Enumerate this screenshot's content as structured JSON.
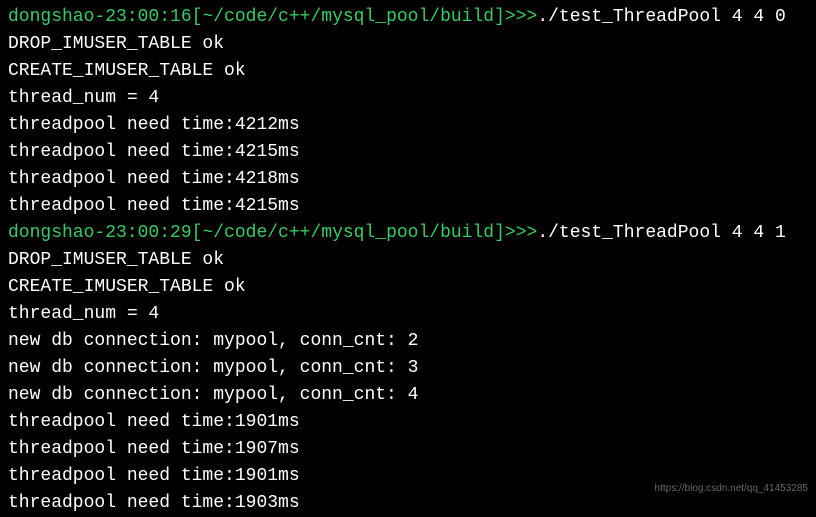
{
  "lines": [
    {
      "type": "prompt",
      "user": "dongshao-23:00:16",
      "path": "[~/code/c++/mysql_pool/build]",
      "arrows": ">>>",
      "command": "./test_ThreadPool 4 4 0"
    },
    {
      "type": "output",
      "text": "DROP_IMUSER_TABLE ok"
    },
    {
      "type": "output",
      "text": "CREATE_IMUSER_TABLE ok"
    },
    {
      "type": "output",
      "text": "thread_num = 4"
    },
    {
      "type": "output",
      "text": "threadpool need time:4212ms"
    },
    {
      "type": "output",
      "text": "threadpool need time:4215ms"
    },
    {
      "type": "output",
      "text": "threadpool need time:4218ms"
    },
    {
      "type": "output",
      "text": "threadpool need time:4215ms"
    },
    {
      "type": "prompt",
      "user": "dongshao-23:00:29",
      "path": "[~/code/c++/mysql_pool/build]",
      "arrows": ">>>",
      "command": "./test_ThreadPool 4 4 1"
    },
    {
      "type": "output",
      "text": "DROP_IMUSER_TABLE ok"
    },
    {
      "type": "output",
      "text": "CREATE_IMUSER_TABLE ok"
    },
    {
      "type": "output",
      "text": "thread_num = 4"
    },
    {
      "type": "output",
      "text": "new db connection: mypool, conn_cnt: 2"
    },
    {
      "type": "output",
      "text": "new db connection: mypool, conn_cnt: 3"
    },
    {
      "type": "output",
      "text": "new db connection: mypool, conn_cnt: 4"
    },
    {
      "type": "output",
      "text": "threadpool need time:1901ms"
    },
    {
      "type": "output",
      "text": "threadpool need time:1907ms"
    },
    {
      "type": "output",
      "text": "threadpool need time:1901ms"
    },
    {
      "type": "output",
      "text": "threadpool need time:1903ms"
    }
  ],
  "watermark": "https://blog.csdn.net/qq_41453285"
}
